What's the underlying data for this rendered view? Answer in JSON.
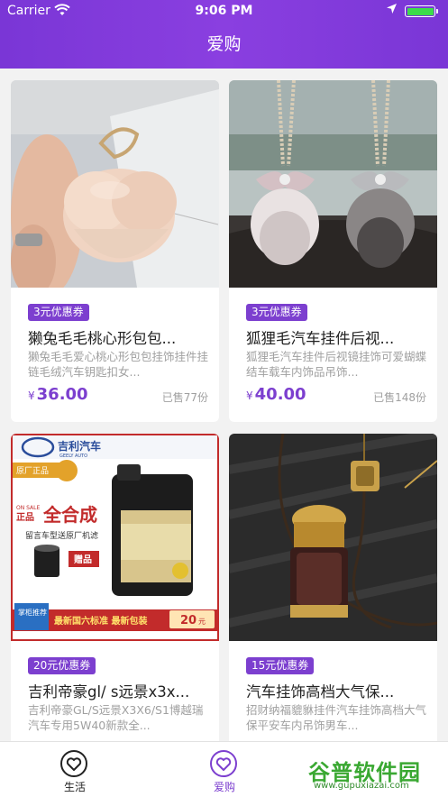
{
  "status_bar": {
    "carrier": "Carrier",
    "time": "9:06 PM"
  },
  "header": {
    "title": "爱购"
  },
  "products": [
    {
      "coupon": "3元优惠券",
      "title": "獭兔毛毛桃心形包包...",
      "desc": "獭兔毛毛爱心桃心形包包挂饰挂件挂链毛绒汽车钥匙扣女...",
      "currency": "¥",
      "price": "36.00",
      "sold": "已售77份"
    },
    {
      "coupon": "3元优惠券",
      "title": "狐狸毛汽车挂件后视...",
      "desc": "狐狸毛汽车挂件后视镜挂饰可爱蝴蝶结车载车内饰品吊饰...",
      "currency": "¥",
      "price": "40.00",
      "sold": "已售148份"
    },
    {
      "coupon": "20元优惠券",
      "title": "吉利帝豪gl/ s远景x3x...",
      "desc": "吉利帝豪GL/S远景X3X6/S1博越瑞汽车专用5W40新款全...",
      "currency": "¥",
      "price": "",
      "sold": ""
    },
    {
      "coupon": "15元优惠券",
      "title": "汽车挂饰高档大气保...",
      "desc": "招财纳福貔貅挂件汽车挂饰高档大气保平安车内吊饰男车...",
      "currency": "¥",
      "price": "",
      "sold": ""
    }
  ],
  "product_image_text": {
    "brand": "吉利汽车",
    "brand_en": "GEELY AUTO",
    "genuine": "原厂正品",
    "on_sale": "ON SALE",
    "zhengpin": "正品",
    "synthetic": "全合成",
    "filter_note": "留言车型送原厂机滤",
    "gift": "赠品",
    "banner": "最新国六标准 最新包装",
    "coupon_amt": "20",
    "coupon_unit": "元",
    "recommend": "掌柜推荐"
  },
  "tabbar": {
    "items": [
      {
        "label": "生活"
      },
      {
        "label": "爱购"
      }
    ]
  },
  "watermark": {
    "text": "谷普软件园",
    "url": "www.gupuxiazai.com"
  },
  "colors": {
    "accent": "#7c3fcf",
    "header": "#8a3fe0"
  }
}
